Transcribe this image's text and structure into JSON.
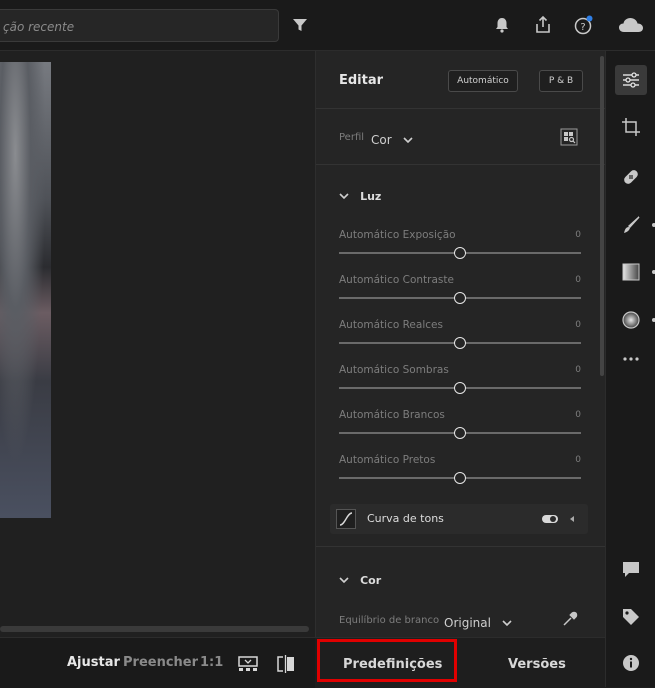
{
  "search": {
    "placeholder": "ção recente"
  },
  "edit_panel": {
    "title": "Editar",
    "auto_button": "Automático",
    "bw_button": "P & B",
    "profile_label": "Perfil",
    "profile_value": "Cor",
    "light_section": "Luz",
    "sliders": [
      {
        "label": "Automático Exposição",
        "value": "0"
      },
      {
        "label": "Automático Contraste",
        "value": "0"
      },
      {
        "label": "Automático Realces",
        "value": "0"
      },
      {
        "label": "Automático Sombras",
        "value": "0"
      },
      {
        "label": "Automático Brancos",
        "value": "0"
      },
      {
        "label": "Automático Pretos",
        "value": "0"
      }
    ],
    "tone_curve": "Curva de tons",
    "color_section": "Cor",
    "wb_label": "Equilíbrio de branco",
    "wb_value": "Original"
  },
  "bottom_bar": {
    "fit": "Ajustar",
    "fill": "Preencher",
    "one_to_one": "1:1"
  },
  "tabs": {
    "presets": "Predefinições",
    "versions": "Versões"
  },
  "colors": {
    "highlight_box": "#e00000",
    "notification_dot": "#2f7fe6"
  }
}
